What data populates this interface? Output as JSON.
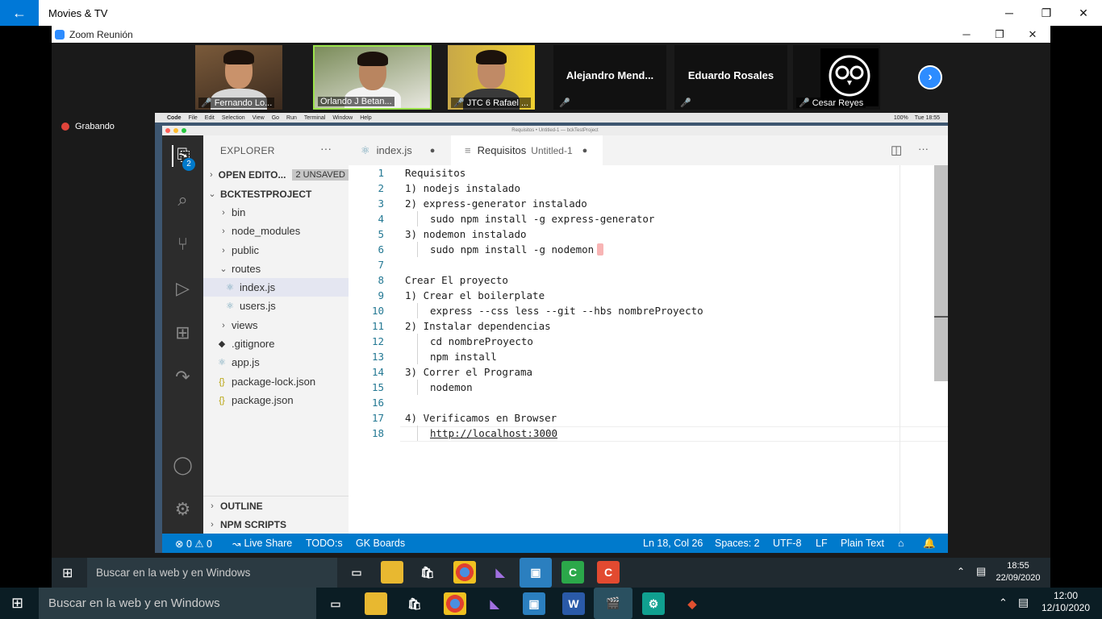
{
  "movies_tv": {
    "title": "Movies & TV",
    "back": "←",
    "minimize": "─",
    "restore": "❐",
    "close": "✕"
  },
  "zoom": {
    "title": "Zoom Reunión",
    "recording": "Grabando",
    "participants": [
      {
        "name": "Fernando Lo...",
        "video": true
      },
      {
        "name": "Orlando J Betan...",
        "video": true,
        "active": true
      },
      {
        "name": "JTC 6 Rafael ...",
        "video": true
      },
      {
        "name": "Alejandro  Mend...",
        "video": false
      },
      {
        "name": "Eduardo Rosales",
        "video": false
      },
      {
        "name": "Cesar Reyes",
        "video": false
      }
    ]
  },
  "mac": {
    "menu": [
      "",
      "Code",
      "File",
      "Edit",
      "Selection",
      "View",
      "Go",
      "Run",
      "Terminal",
      "Window",
      "Help"
    ],
    "status": {
      "battery": "100%",
      "clock": "Tue 18:55"
    },
    "window_title": "Requisitos • Untitled-1 — bckTestProject"
  },
  "vscode": {
    "activity_badge": "2",
    "explorer": {
      "header": "EXPLORER",
      "more": "···",
      "open_editors": "OPEN EDITO...",
      "unsaved": "2 UNSAVED",
      "project": "BCKTESTPROJECT",
      "items": [
        {
          "label": "bin",
          "kind": "folder",
          "open": false
        },
        {
          "label": "node_modules",
          "kind": "folder",
          "open": false
        },
        {
          "label": "public",
          "kind": "folder",
          "open": false
        },
        {
          "label": "routes",
          "kind": "folder",
          "open": true
        },
        {
          "label": "index.js",
          "kind": "js",
          "child": true,
          "selected": true
        },
        {
          "label": "users.js",
          "kind": "js",
          "child": true
        },
        {
          "label": "views",
          "kind": "folder",
          "open": false
        },
        {
          "label": ".gitignore",
          "kind": "git"
        },
        {
          "label": "app.js",
          "kind": "js"
        },
        {
          "label": "package-lock.json",
          "kind": "json"
        },
        {
          "label": "package.json",
          "kind": "json"
        }
      ],
      "outline": "OUTLINE",
      "npm": "NPM SCRIPTS"
    },
    "tabs": [
      {
        "label": "index.js",
        "dirty": "●"
      },
      {
        "label": "Requisitos",
        "sub": "Untitled-1",
        "dirty": "●",
        "active": true
      }
    ],
    "lines": [
      {
        "n": "1",
        "text": "Requisitos",
        "indent": false
      },
      {
        "n": "2",
        "text": "1) nodejs instalado",
        "indent": false
      },
      {
        "n": "3",
        "text": "2) express-generator instalado",
        "indent": false
      },
      {
        "n": "4",
        "text": "sudo npm install -g express-generator",
        "indent": true
      },
      {
        "n": "5",
        "text": "3) nodemon instalado",
        "indent": false
      },
      {
        "n": "6",
        "text": "sudo npm install -g nodemon",
        "indent": true
      },
      {
        "n": "7",
        "text": "",
        "indent": false
      },
      {
        "n": "8",
        "text": "Crear El proyecto",
        "indent": false
      },
      {
        "n": "9",
        "text": "1) Crear el boilerplate",
        "indent": false
      },
      {
        "n": "10",
        "text": "express --css less --git --hbs nombreProyecto",
        "indent": true
      },
      {
        "n": "11",
        "text": "2) Instalar dependencias",
        "indent": false
      },
      {
        "n": "12",
        "text": "cd nombreProyecto",
        "indent": true
      },
      {
        "n": "13",
        "text": "npm install",
        "indent": true
      },
      {
        "n": "14",
        "text": "3) Correr el Programa",
        "indent": false
      },
      {
        "n": "15",
        "text": "nodemon",
        "indent": true
      },
      {
        "n": "16",
        "text": "",
        "indent": false
      },
      {
        "n": "17",
        "text": "4) Verificamos en Browser",
        "indent": false
      },
      {
        "n": "18",
        "text": "http://localhost:3000",
        "indent": true
      }
    ],
    "status": {
      "errors": "⊗ 0 ⚠ 0",
      "live_share": "Live Share",
      "todo": "TODO:s",
      "gk": "GK Boards",
      "position": "Ln 18, Col 26",
      "spaces": "Spaces: 2",
      "encoding": "UTF-8",
      "eol": "LF",
      "language": "Plain Text"
    }
  },
  "taskbar_inner": {
    "search": "Buscar en la web y en Windows",
    "time": "18:55",
    "date": "22/09/2020"
  },
  "taskbar_outer": {
    "search": "Buscar en la web y en Windows",
    "time": "12:00",
    "date": "12/10/2020"
  },
  "colors": {
    "accent": "#0078d7",
    "vscode_status": "#007acc",
    "zoom_blue": "#2d8cff"
  }
}
